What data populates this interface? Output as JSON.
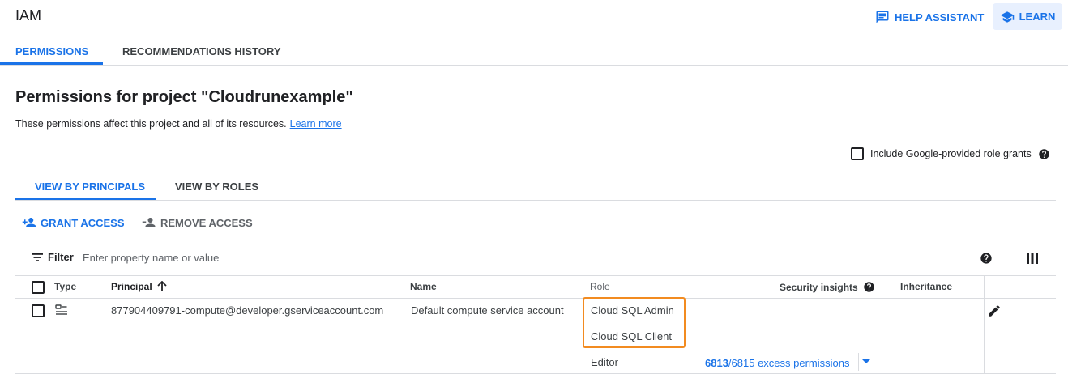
{
  "header": {
    "title": "IAM",
    "help_label": "HELP ASSISTANT",
    "learn_label": "LEARN"
  },
  "tabs": [
    {
      "label": "PERMISSIONS",
      "active": true
    },
    {
      "label": "RECOMMENDATIONS HISTORY",
      "active": false
    }
  ],
  "section": {
    "title": "Permissions for project \"Cloudrunexample\"",
    "description": "These permissions affect this project and all of its resources.",
    "learn_more": "Learn more",
    "include_label": "Include Google-provided role grants"
  },
  "view_tabs": [
    {
      "label": "VIEW BY PRINCIPALS",
      "active": true
    },
    {
      "label": "VIEW BY ROLES",
      "active": false
    }
  ],
  "actions": {
    "grant": "GRANT ACCESS",
    "remove": "REMOVE ACCESS"
  },
  "filter": {
    "label": "Filter",
    "placeholder": "Enter property name or value"
  },
  "table": {
    "columns": [
      "Type",
      "Principal",
      "Name",
      "Role",
      "Security insights",
      "Inheritance"
    ],
    "rows": [
      {
        "principal": "877904409791-compute@developer.gserviceaccount.com",
        "name": "Default compute service account",
        "roles": [
          "Cloud SQL Admin",
          "Cloud SQL Client",
          "Editor"
        ],
        "insight_count": "6813",
        "insight_rest": "/6815 excess permissions"
      }
    ]
  },
  "colors": {
    "accent": "#1a73e8",
    "highlight": "#f28b20"
  },
  "icons": [
    "chat-icon",
    "school-cap-icon",
    "person-add-icon",
    "person-remove-icon",
    "filter-icon",
    "help-icon",
    "columns-icon",
    "arrow-up-icon",
    "service-account-icon",
    "pencil-icon",
    "dropdown-arrow-icon"
  ]
}
